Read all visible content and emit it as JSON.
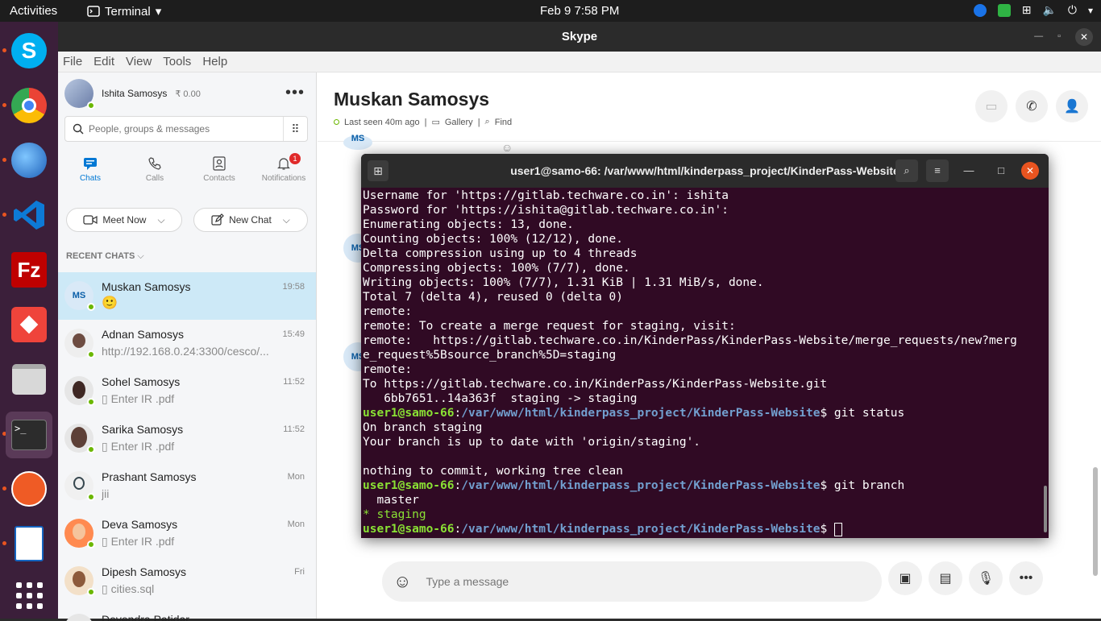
{
  "topbar": {
    "activities": "Activities",
    "app_name": "Terminal",
    "datetime": "Feb 9  7:58 PM"
  },
  "skype": {
    "window_title": "Skype",
    "menu": [
      "File",
      "Edit",
      "View",
      "Tools",
      "Help"
    ],
    "profile": {
      "name": "Ishita Samosys",
      "credit": "₹ 0.00"
    },
    "search_placeholder": "People, groups & messages",
    "tabs": [
      {
        "label": "Chats",
        "icon": "chat-icon"
      },
      {
        "label": "Calls",
        "icon": "phone-icon"
      },
      {
        "label": "Contacts",
        "icon": "contacts-icon"
      },
      {
        "label": "Notifications",
        "icon": "bell-icon",
        "badge": "1"
      }
    ],
    "meet_now": "Meet Now",
    "new_chat": "New Chat",
    "recent_chats_header": "RECENT CHATS",
    "chats": [
      {
        "name": "Muskan Samosys",
        "time": "19:58",
        "preview": "🙂",
        "initials": "MS"
      },
      {
        "name": "Adnan Samosys",
        "time": "15:49",
        "preview": "http://192.168.0.24:3300/cesco/..."
      },
      {
        "name": "Sohel Samosys",
        "time": "11:52",
        "preview": "Enter IR .pdf"
      },
      {
        "name": "Sarika Samosys",
        "time": "11:52",
        "preview": "Enter IR .pdf"
      },
      {
        "name": "Prashant Samosys",
        "time": "Mon",
        "preview": "jii"
      },
      {
        "name": "Deva Samosys",
        "time": "Mon",
        "preview": "Enter IR .pdf"
      },
      {
        "name": "Dipesh Samosys",
        "time": "Fri",
        "preview": "cities.sql"
      },
      {
        "name": "Devendra Patidar",
        "time": "",
        "preview": ""
      }
    ],
    "conversation": {
      "title": "Muskan Samosys",
      "last_seen": "Last seen 40m ago",
      "gallery": "Gallery",
      "find": "Find",
      "message_placeholder": "Type a message",
      "avatar_initials": "MS"
    }
  },
  "terminal": {
    "title": "user1@samo-66: /var/www/html/kinderpass_project/KinderPass-Website",
    "lines_1": [
      "Username for 'https://gitlab.techware.co.in': ishita",
      "Password for 'https://ishita@gitlab.techware.co.in':",
      "Enumerating objects: 13, done.",
      "Counting objects: 100% (12/12), done.",
      "Delta compression using up to 4 threads",
      "Compressing objects: 100% (7/7), done.",
      "Writing objects: 100% (7/7), 1.31 KiB | 1.31 MiB/s, done.",
      "Total 7 (delta 4), reused 0 (delta 0)",
      "remote:",
      "remote: To create a merge request for staging, visit:",
      "remote:   https://gitlab.techware.co.in/KinderPass/KinderPass-Website/merge_requests/new?merg",
      "e_request%5Bsource_branch%5D=staging",
      "remote:",
      "To https://gitlab.techware.co.in/KinderPass/KinderPass-Website.git",
      "   6bb7651..14a363f  staging -> staging"
    ],
    "prompt_user": "user1@samo-66",
    "prompt_path": "/var/www/html/kinderpass_project/KinderPass-Website",
    "cmd_status": "git status",
    "status_lines": [
      "On branch staging",
      "Your branch is up to date with 'origin/staging'.",
      "",
      "nothing to commit, working tree clean"
    ],
    "cmd_branch": "git branch",
    "branch_master": "  master",
    "branch_staging": "* staging"
  }
}
